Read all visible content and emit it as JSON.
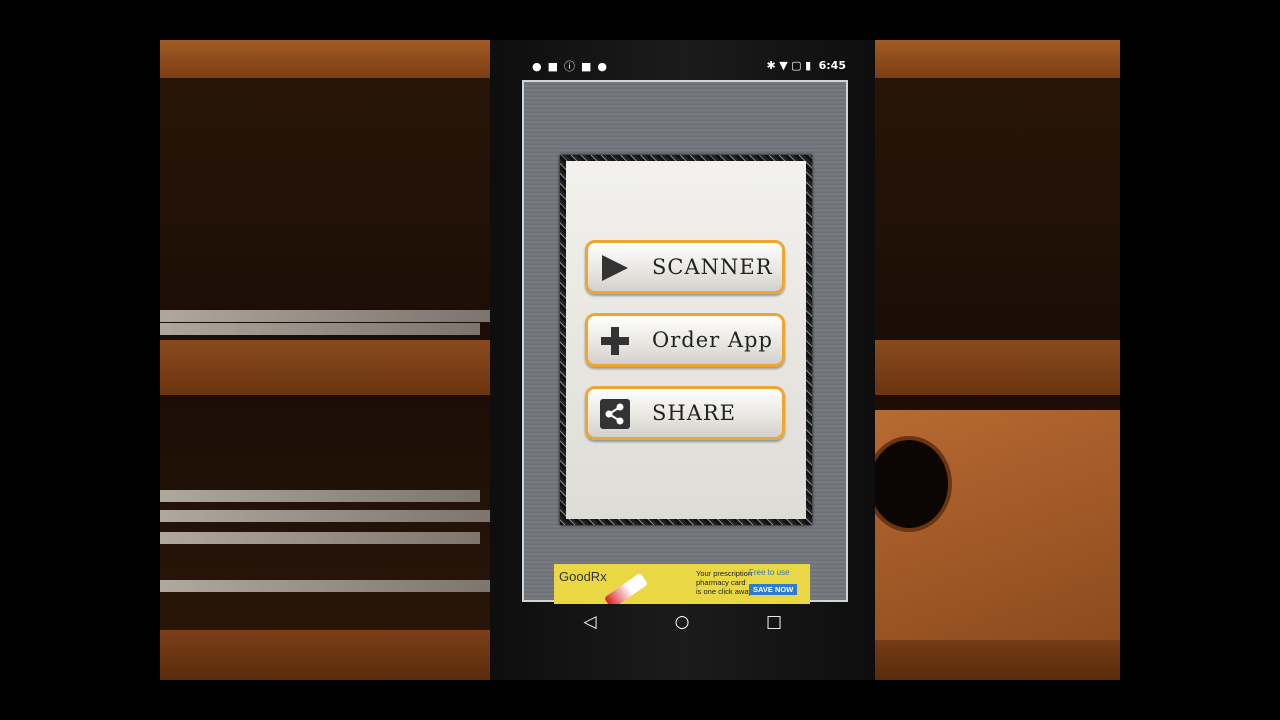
{
  "status_bar": {
    "time": "6:45",
    "left_icons": [
      "notification-icon",
      "messages-icon",
      "info-icon",
      "lock-icon",
      "android-icon"
    ],
    "right_icons": [
      "bluetooth-icon",
      "wifi-icon",
      "no-sim-icon",
      "battery-icon"
    ]
  },
  "menu": {
    "buttons": [
      {
        "label": "SCANNER",
        "icon": "play-icon"
      },
      {
        "label": "Order App",
        "icon": "plus-icon"
      },
      {
        "label": "SHARE",
        "icon": "share-icon"
      }
    ]
  },
  "ad": {
    "brand": "GoodRx",
    "text_line1": "Your prescription",
    "text_line2": "pharmacy card",
    "text_line3": "is one click away",
    "free_text": "Free to use",
    "cta": "SAVE NOW"
  },
  "nav_bar": {
    "back_icon": "back-icon",
    "home_icon": "home-icon",
    "recent_icon": "recent-apps-icon"
  },
  "colors": {
    "button_border": "#f0a431",
    "ad_background": "#e9d843",
    "ad_accent": "#2f7bd1"
  }
}
